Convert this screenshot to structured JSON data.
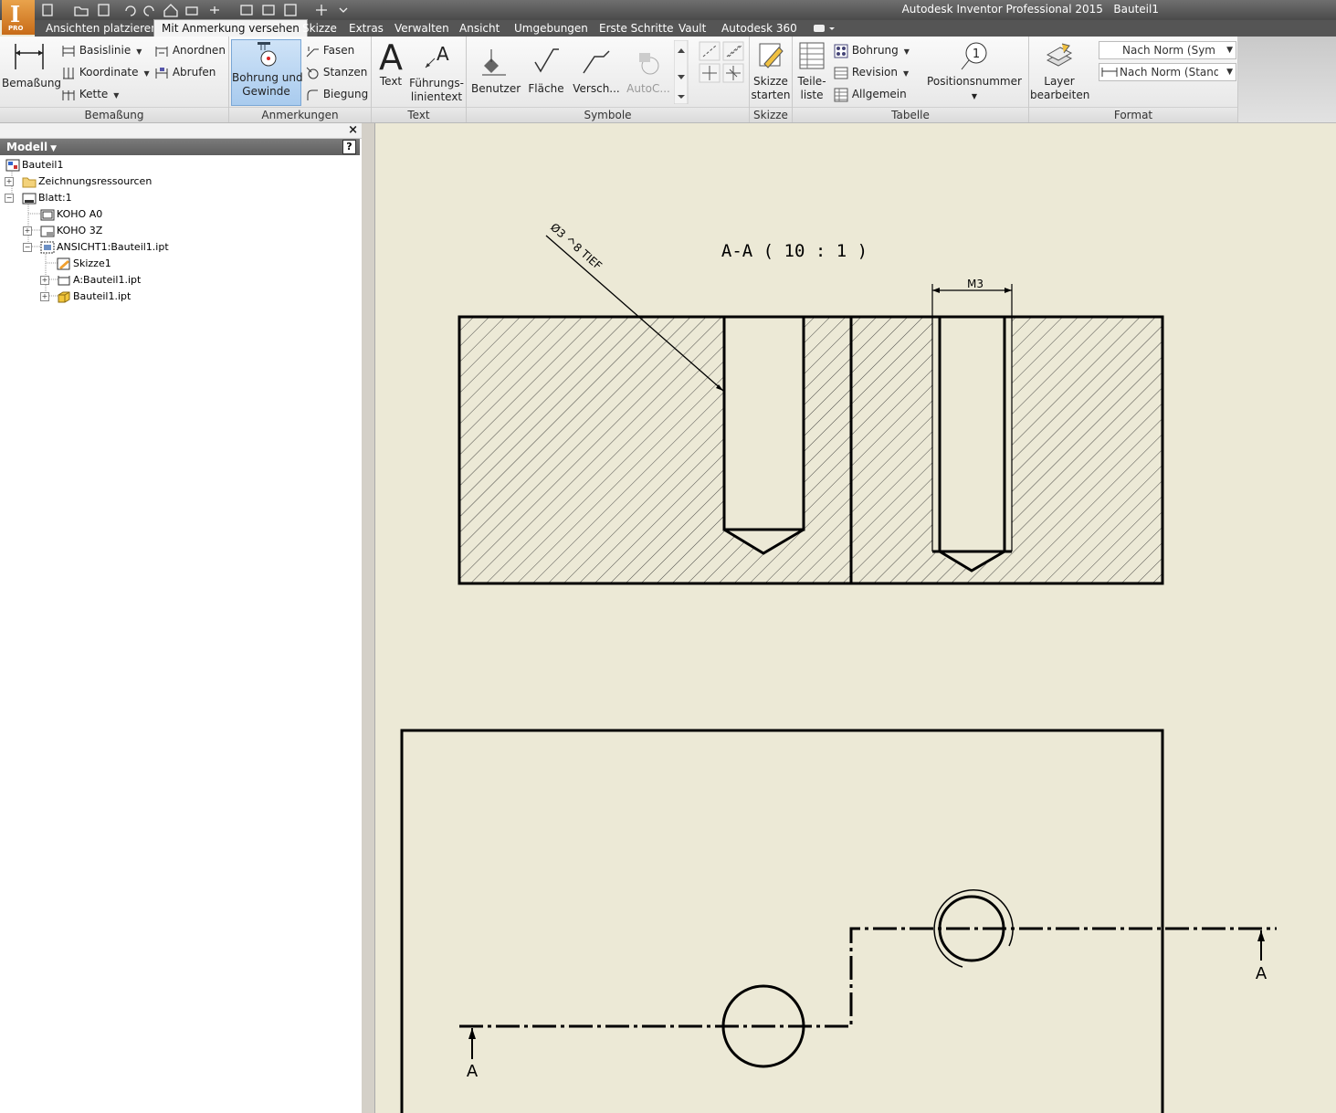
{
  "window": {
    "app_title": "Autodesk Inventor Professional 2015",
    "doc_title": "Bauteil1"
  },
  "logo": {
    "letter": "I",
    "edition": "PRO"
  },
  "tabs": [
    {
      "label": "Ansichten platzieren"
    },
    {
      "label": "Mit Anmerkung versehen",
      "active": true
    },
    {
      "label": "Skizze"
    },
    {
      "label": "Extras"
    },
    {
      "label": "Verwalten"
    },
    {
      "label": "Ansicht"
    },
    {
      "label": "Umgebungen"
    },
    {
      "label": "Erste Schritte"
    },
    {
      "label": "Vault"
    },
    {
      "label": "Autodesk 360"
    }
  ],
  "ribbon": {
    "bemassung": {
      "label": "Bemaßung",
      "main": "Bemaßung",
      "basislinie": "Basislinie",
      "koordinate": "Koordinate",
      "kette": "Kette",
      "anordnen": "Anordnen",
      "abrufen": "Abrufen"
    },
    "anmerkungen": {
      "label": "Anmerkungen",
      "bohrung_l1": "Bohrung und",
      "bohrung_l2": "Gewinde",
      "fasen": "Fasen",
      "stanzen": "Stanzen",
      "biegung": "Biegung"
    },
    "text": {
      "label": "Text",
      "text": "Text",
      "fuehrung_l1": "Führungs-",
      "fuehrung_l2": "linientext"
    },
    "symbole": {
      "label": "Symbole",
      "benutzer": "Benutzer",
      "flaeche": "Fläche",
      "versch": "Versch...",
      "autoc": "AutoC..."
    },
    "skizze": {
      "label": "Skizze",
      "start_l1": "Skizze",
      "start_l2": "starten"
    },
    "tabelle": {
      "label": "Tabelle",
      "teile_l1": "Teile-",
      "teile_l2": "liste",
      "bohrung": "Bohrung",
      "revision": "Revision",
      "allgemein": "Allgemein",
      "positionsnummer": "Positionsnummer",
      "balloon_number": "1"
    },
    "format": {
      "label": "Format",
      "layer_l1": "Layer",
      "layer_l2": "bearbeiten",
      "style1": "Nach Norm (Sym",
      "style2": "Nach Norm (Standa"
    }
  },
  "browser": {
    "title": "Modell",
    "close": "×",
    "help": "?",
    "tree": [
      {
        "label": "Bauteil1"
      },
      {
        "label": "Zeichnungsressourcen"
      },
      {
        "label": "Blatt:1"
      },
      {
        "label": "KOHO A0"
      },
      {
        "label": "KOHO 3Z"
      },
      {
        "label": "ANSICHT1:Bauteil1.ipt"
      },
      {
        "label": "Skizze1"
      },
      {
        "label": "A:Bauteil1.ipt"
      },
      {
        "label": "Bauteil1.ipt"
      }
    ]
  },
  "drawing": {
    "view_label": "A-A ( 10 : 1 )",
    "hole_note_diameter": "Ø3",
    "hole_note_depth": "8 TIEF",
    "thread_dim": "M3",
    "section_letter_right": "A",
    "section_letter_left": "A"
  }
}
